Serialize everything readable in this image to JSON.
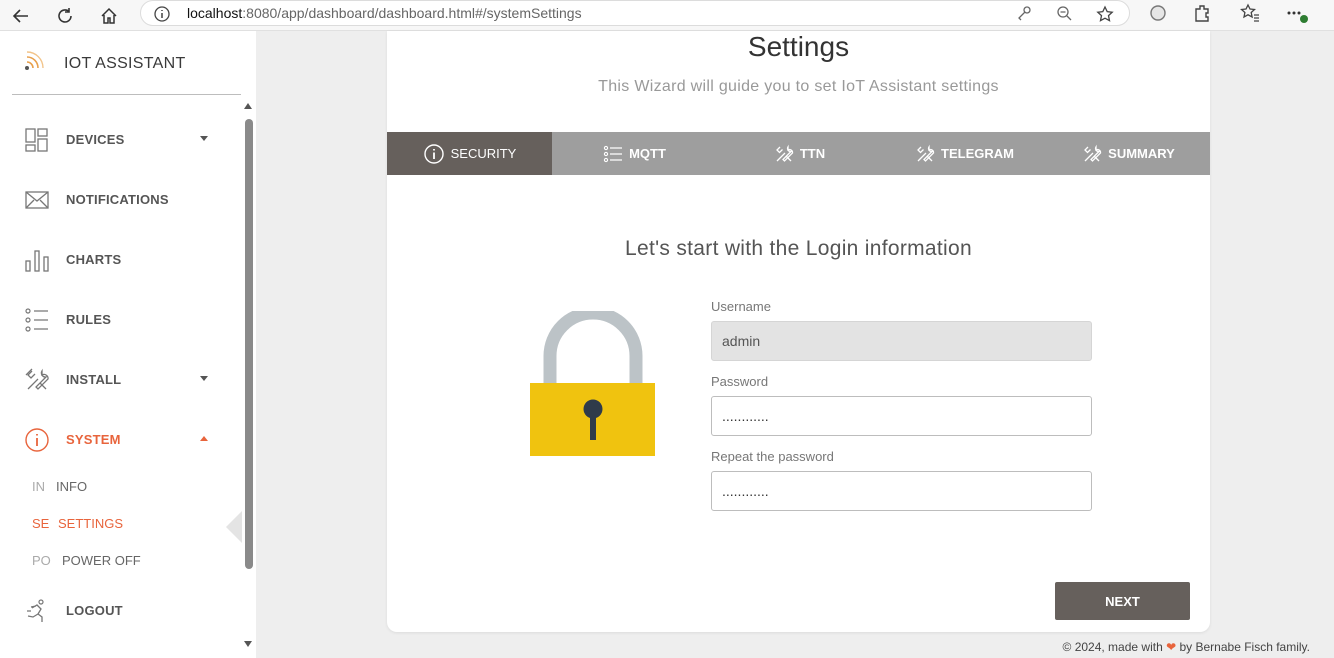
{
  "browser": {
    "url_host": "localhost",
    "url_rest": ":8080/app/dashboard/dashboard.html#/systemSettings"
  },
  "sidebar": {
    "brand": "IOT ASSISTANT",
    "items": [
      {
        "label": "DEVICES",
        "icon": "dashboard-grid-icon",
        "caret": "down"
      },
      {
        "label": "NOTIFICATIONS",
        "icon": "envelope-icon"
      },
      {
        "label": "CHARTS",
        "icon": "bar-chart-icon"
      },
      {
        "label": "RULES",
        "icon": "list-icon"
      },
      {
        "label": "INSTALL",
        "icon": "tools-icon",
        "caret": "down"
      },
      {
        "label": "SYSTEM",
        "icon": "info-icon",
        "caret": "up",
        "active": true
      }
    ],
    "subitems": [
      {
        "abbr": "IN",
        "label": "INFO"
      },
      {
        "abbr": "SE",
        "label": "SETTINGS",
        "active": true
      },
      {
        "abbr": "PO",
        "label": "POWER OFF"
      }
    ],
    "logout": "LOGOUT"
  },
  "main": {
    "title": "Settings",
    "subtitle": "This Wizard will guide you to set IoT Assistant settings",
    "tabs": [
      {
        "label": "SECURITY",
        "icon": "info-icon",
        "active": true
      },
      {
        "label": "MQTT",
        "icon": "list-icon"
      },
      {
        "label": "TTN",
        "icon": "tools-icon"
      },
      {
        "label": "TELEGRAM",
        "icon": "tools-icon"
      },
      {
        "label": "SUMMARY",
        "icon": "tools-icon"
      }
    ],
    "section_title": "Let's start with the Login information",
    "username_label": "Username",
    "username_value": "admin",
    "password_label": "Password",
    "password_value": "............",
    "repeat_label": "Repeat the password",
    "repeat_value": "............",
    "next_label": "NEXT"
  },
  "footer": {
    "prefix": "© 2024, made with",
    "heart": "❤",
    "suffix": "by Bernabe Fisch family."
  },
  "colors": {
    "accent": "#e8643c",
    "tab_active": "#66605c",
    "tab_bar": "#9e9e9e",
    "lock_body": "#f0c30f",
    "lock_shackle": "#bcc3c7"
  }
}
